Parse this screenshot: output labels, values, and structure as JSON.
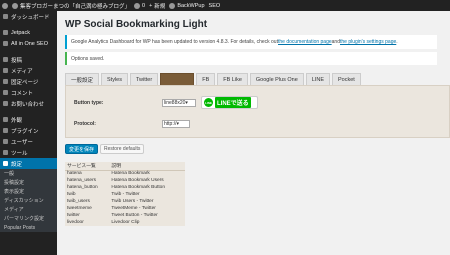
{
  "adminbar": {
    "site_name": "集客ブロガーまつの「自己満の極みブログ」",
    "comments_count": "0",
    "new_label": "新規",
    "backwpup_label": "BackWPup",
    "seo_label": "SEO"
  },
  "sidebar": {
    "items": [
      {
        "label": "ダッシュボード",
        "icon": "dashboard-icon"
      },
      {
        "label": "Jetpack",
        "icon": "jetpack-icon"
      },
      {
        "label": "All in One SEO",
        "icon": "seo-icon"
      },
      {
        "label": "投稿",
        "icon": "pin-icon"
      },
      {
        "label": "メディア",
        "icon": "media-icon"
      },
      {
        "label": "固定ページ",
        "icon": "page-icon"
      },
      {
        "label": "コメント",
        "icon": "comment-icon"
      },
      {
        "label": "お問い合わせ",
        "icon": "mail-icon"
      },
      {
        "label": "外観",
        "icon": "brush-icon"
      },
      {
        "label": "プラグイン",
        "icon": "plugin-icon"
      },
      {
        "label": "ユーザー",
        "icon": "user-icon"
      },
      {
        "label": "ツール",
        "icon": "wrench-icon"
      },
      {
        "label": "設定",
        "icon": "settings-icon"
      }
    ],
    "submenu": [
      "一般",
      "投稿設定",
      "表示設定",
      "ディスカッション",
      "メディア",
      "パーマリンク設定",
      "Popular Posts"
    ]
  },
  "page": {
    "title": "WP Social Bookmarking Light",
    "notice_text": "Google Analytics Dashboard for WP has been updated to version 4.8.3. For details, check out ",
    "notice_link1": "the documentation page",
    "notice_and": " and ",
    "notice_link2": "the plugin's settings page",
    "notice_end": ".",
    "saved_notice": "Options saved."
  },
  "tabs": [
    "一般設定",
    "Styles",
    "Twitter",
    "",
    "FB",
    "FB Like",
    "Google Plus One",
    "LINE",
    "Pocket"
  ],
  "line_panel": {
    "button_type_label": "Button type:",
    "button_type_value": "line88x20",
    "line_logo_text": "LINE",
    "line_button_text": "LINEで送る",
    "protocol_label": "Protocol:",
    "protocol_value": "http://"
  },
  "buttons": {
    "save": "変更を保存",
    "restore": "Restore defaults"
  },
  "service_table": {
    "headers": [
      "サービス一覧",
      "説明"
    ],
    "rows": [
      [
        "hatena",
        "Hatena Bookmark"
      ],
      [
        "hatena_users",
        "Hatena Bookmark Users"
      ],
      [
        "hatena_button",
        "Hatena Bookmark Button"
      ],
      [
        "twib",
        "Twib - Twitter"
      ],
      [
        "twib_users",
        "Twib Users - Twitter"
      ],
      [
        "tweetmeme",
        "TweetMeme - Twitter"
      ],
      [
        "twitter",
        "Tweet Button - Twitter"
      ],
      [
        "livedoor",
        "Livedoor Clip"
      ]
    ]
  },
  "colors": {
    "admin_bar": "#222222",
    "active_menu": "#0073aa",
    "active_tab": "#7a5c38",
    "primary_button": "#0085ba",
    "line_green": "#00b900"
  }
}
